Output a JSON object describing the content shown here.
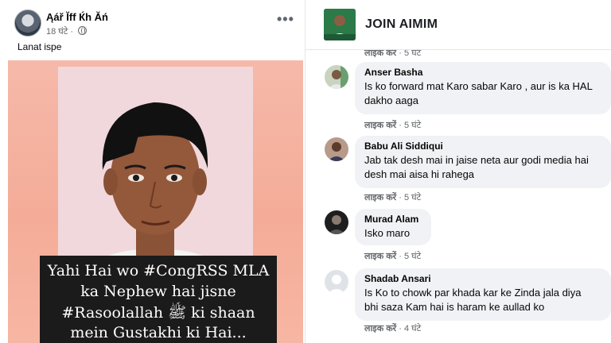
{
  "post": {
    "author": "Ąář Ĭff Ќh Ăń",
    "time": "18 घंटे",
    "separator": "·",
    "more": "•••",
    "text": "Lanat ispe",
    "image_overlay_lines": [
      "Yahi Hai wo #CongRSS MLA",
      "ka Nephew hai jisne",
      "#Rasoolallah ﷺ ki shaan",
      "mein Gustakhi ki Hai..."
    ]
  },
  "group": {
    "title": "JOIN AIMIM"
  },
  "comments": {
    "top_action": {
      "like": "लाइक करें",
      "sep": "·",
      "time": "5 घंटे"
    },
    "items": [
      {
        "name": "Anser Basha",
        "lines": [
          "Is ko forward mat Karo sabar Karo , aur is ka HAL",
          "dakho aaga"
        ],
        "like": "लाइक करें",
        "sep": "·",
        "time": "5 घंटे"
      },
      {
        "name": "Babu Ali Siddiqui",
        "lines": [
          "Jab tak desh mai in jaise neta aur godi media hai",
          "desh mai aisa hi rahega"
        ],
        "like": "लाइक करें",
        "sep": "·",
        "time": "5 घंटे"
      },
      {
        "name": "Murad Alam",
        "lines": [
          "Isko maro"
        ],
        "like": "लाइक करें",
        "sep": "·",
        "time": "5 घंटे"
      },
      {
        "name": "Shadab Ansari",
        "lines": [
          "Is Ko to chowk par khada kar ke Zinda jala diya",
          "bhi saza Kam hai is haram ke aullad ko"
        ],
        "like": "लाइक करें",
        "sep": "·",
        "time": "4 घंटे"
      }
    ]
  }
}
